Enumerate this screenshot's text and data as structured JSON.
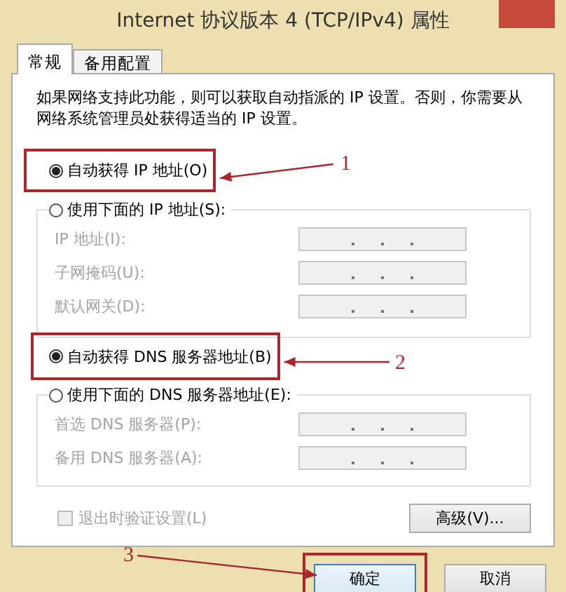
{
  "window": {
    "title": "Internet 协议版本 4 (TCP/IPv4) 属性"
  },
  "tabs": [
    {
      "label": "常规",
      "selected": true
    },
    {
      "label": "备用配置",
      "selected": false
    }
  ],
  "info_text": "如果网络支持此功能，则可以获取自动指派的 IP 设置。否则，你需要从网络系统管理员处获得适当的 IP 设置。",
  "ip_mode": [
    {
      "label": "自动获得 IP 地址(O)",
      "selected": true
    },
    {
      "label": "使用下面的 IP 地址(S):",
      "selected": false
    }
  ],
  "ip_fields": [
    {
      "label": "IP 地址(I):",
      "disabled": true
    },
    {
      "label": "子网掩码(U):",
      "disabled": true
    },
    {
      "label": "默认网关(D):",
      "disabled": true
    }
  ],
  "dns_mode": [
    {
      "label": "自动获得 DNS 服务器地址(B)",
      "selected": true
    },
    {
      "label": "使用下面的 DNS 服务器地址(E):",
      "selected": false
    }
  ],
  "dns_fields": [
    {
      "label": "首选 DNS 服务器(P):",
      "disabled": true
    },
    {
      "label": "备用 DNS 服务器(A):",
      "disabled": true
    }
  ],
  "validate_on_exit": {
    "label": "退出时验证设置(L)",
    "checked": false,
    "disabled": true
  },
  "advanced_button": "高级(V)...",
  "buttons": [
    "确定",
    "取消"
  ],
  "annotations": [
    {
      "number": "1"
    },
    {
      "number": "2"
    },
    {
      "number": "3"
    }
  ]
}
